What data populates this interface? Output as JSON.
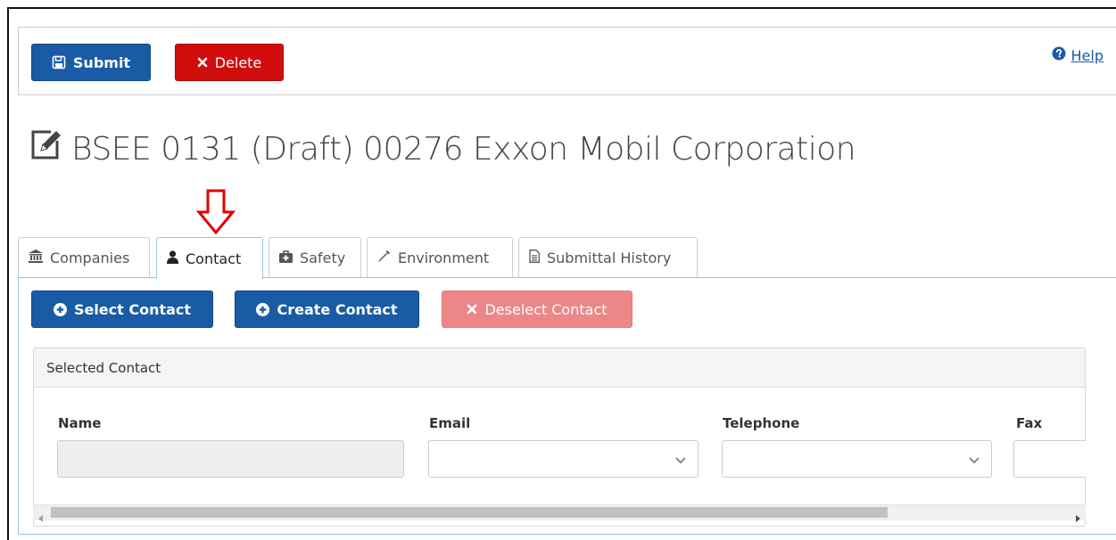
{
  "toolbar": {
    "submit_label": "Submit",
    "delete_label": "Delete",
    "help_label": "Help"
  },
  "page": {
    "title": "BSEE 0131 (Draft) 00276 Exxon Mobil Corporation"
  },
  "tabs": [
    {
      "label": "Companies",
      "icon": "bank-icon",
      "active": false
    },
    {
      "label": "Contact",
      "icon": "user-icon",
      "active": true
    },
    {
      "label": "Safety",
      "icon": "medkit-icon",
      "active": false
    },
    {
      "label": "Environment",
      "icon": "eyedropper-icon",
      "active": false
    },
    {
      "label": "Submittal History",
      "icon": "document-icon",
      "active": false
    }
  ],
  "contact": {
    "select_label": "Select Contact",
    "create_label": "Create Contact",
    "deselect_label": "Deselect Contact",
    "panel_heading": "Selected Contact",
    "fields": {
      "name": {
        "label": "Name",
        "value": ""
      },
      "email": {
        "label": "Email",
        "value": ""
      },
      "telephone": {
        "label": "Telephone",
        "value": ""
      },
      "fax": {
        "label": "Fax",
        "value": ""
      }
    }
  },
  "colors": {
    "primary": "#1a5ba6",
    "danger": "#d00c0c",
    "danger_disabled": "#ec8787",
    "annotation_arrow": "#e00000"
  }
}
